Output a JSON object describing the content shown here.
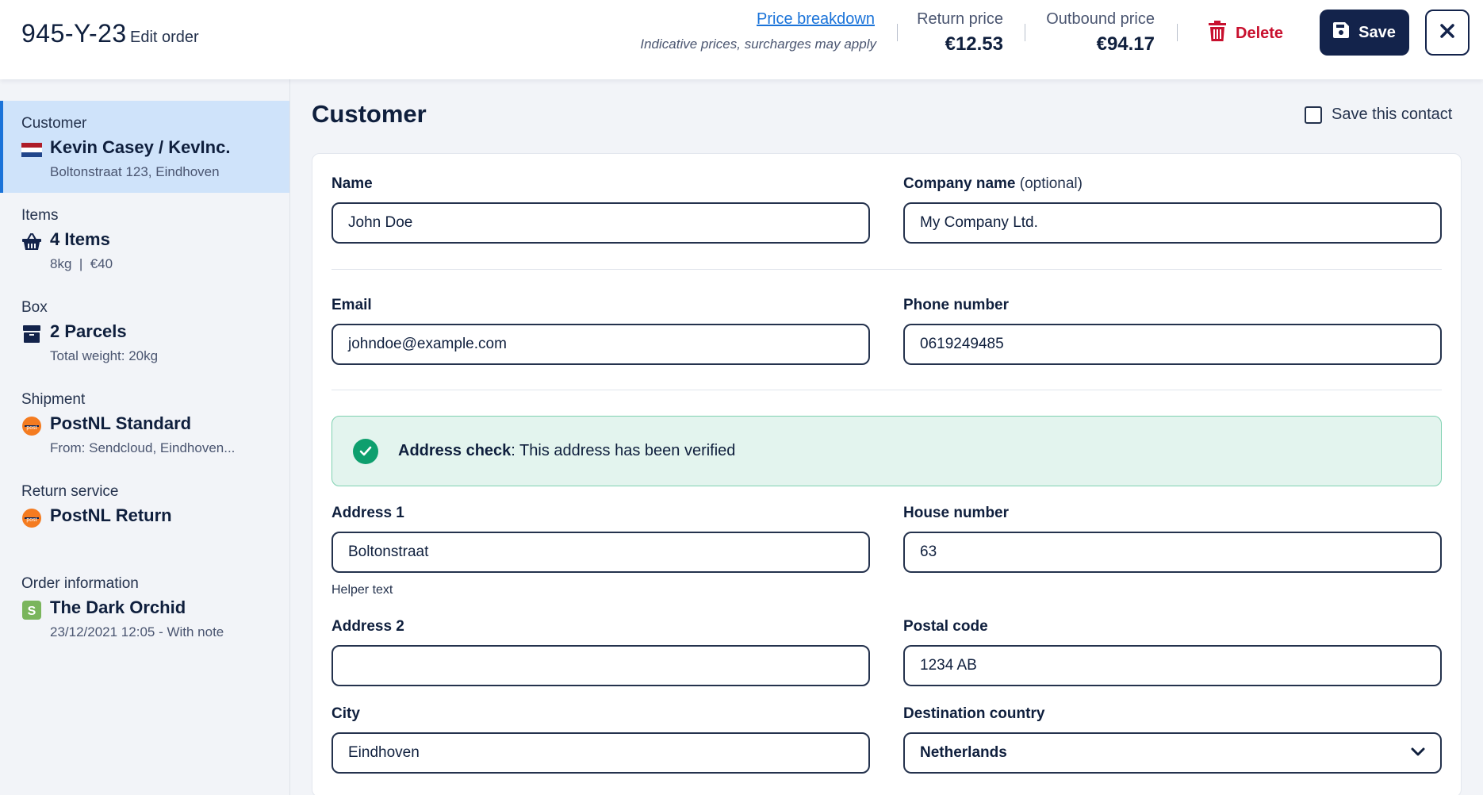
{
  "header": {
    "order_id": "945-Y-23",
    "subtitle": "Edit order",
    "price_breakdown_link": "Price breakdown",
    "price_note": "Indicative prices, surcharges may apply",
    "return_price_label": "Return price",
    "return_price_value": "€12.53",
    "outbound_price_label": "Outbound price",
    "outbound_price_value": "€94.17",
    "delete_label": "Delete",
    "save_label": "Save",
    "colors": {
      "primary": "#13234b",
      "danger": "#c8102e",
      "link": "#1a73d9"
    }
  },
  "sidebar": {
    "items": [
      {
        "category": "Customer",
        "title": "Kevin Casey / KevInc.",
        "subtitle": "Boltonstraat 123, Eindhoven",
        "icon": "netherlands-flag-icon",
        "active": true
      },
      {
        "category": "Items",
        "title": "4 Items",
        "subtitle": "8kg  |  €40",
        "icon": "basket-icon",
        "active": false
      },
      {
        "category": "Box",
        "title": "2 Parcels",
        "subtitle": "Total weight: 20kg",
        "icon": "box-icon",
        "active": false
      },
      {
        "category": "Shipment",
        "title": "PostNL Standard",
        "subtitle": "From: Sendcloud, Eindhoven...",
        "icon": "postnl-icon",
        "active": false
      },
      {
        "category": "Return service",
        "title": "PostNL Return",
        "subtitle": "",
        "icon": "postnl-icon",
        "active": false
      },
      {
        "category": "Order information",
        "title": "The Dark Orchid",
        "subtitle": "23/12/2021 12:05 - With note",
        "icon": "shopify-icon",
        "active": false
      }
    ]
  },
  "main": {
    "section_title": "Customer",
    "save_contact_label": "Save this contact",
    "save_contact_checked": false,
    "form": {
      "name_label": "Name",
      "name_value": "John Doe",
      "company_label": "Company name",
      "company_optional": " (optional)",
      "company_value": "My Company Ltd.",
      "email_label": "Email",
      "email_value": "johndoe@example.com",
      "phone_label": "Phone number",
      "phone_value": "0619249485",
      "address_check_bold": "Address check",
      "address_check_text": ": This address has been verified",
      "address1_label": "Address 1",
      "address1_value": "Boltonstraat",
      "address1_helper": "Helper text",
      "house_number_label": "House number",
      "house_number_value": "63",
      "address2_label": "Address 2",
      "address2_value": "",
      "postal_code_label": "Postal code",
      "postal_code_value": "1234 AB",
      "city_label": "City",
      "city_value": "Eindhoven",
      "country_label": "Destination country",
      "country_value": "Netherlands"
    }
  }
}
